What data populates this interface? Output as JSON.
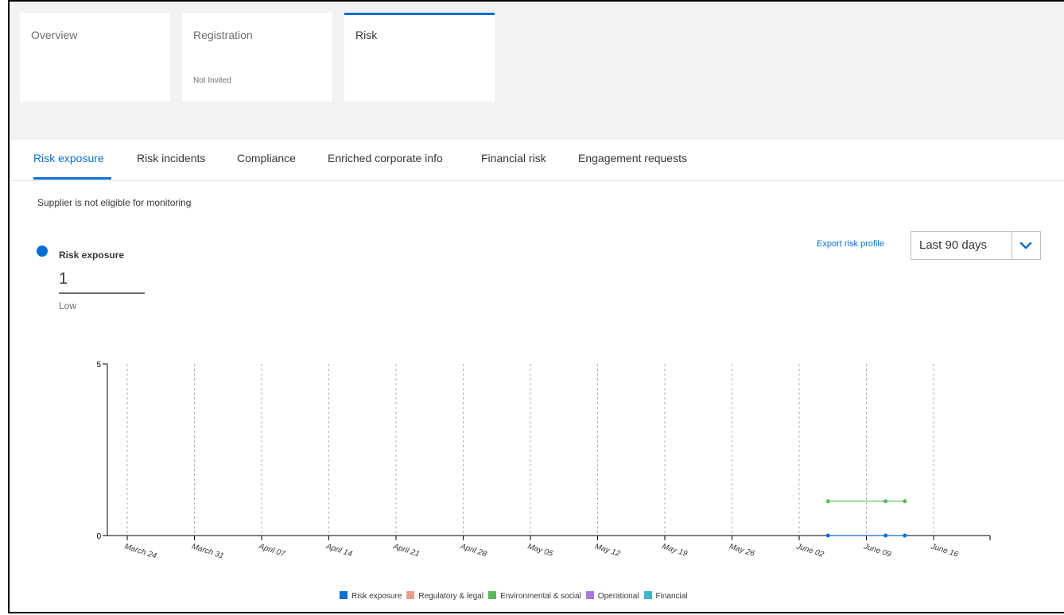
{
  "tiles": [
    {
      "title": "Overview",
      "subtitle": ""
    },
    {
      "title": "Registration",
      "subtitle": "Not Invited"
    },
    {
      "title": "Risk",
      "subtitle": ""
    }
  ],
  "tabs": [
    {
      "label": "Risk exposure",
      "active": true
    },
    {
      "label": "Risk incidents"
    },
    {
      "label": "Compliance"
    },
    {
      "label": "Enriched corporate info"
    },
    {
      "label": "Financial risk"
    },
    {
      "label": "Engagement requests"
    }
  ],
  "eligibility_message": "Supplier is not eligible for monitoring",
  "risk_summary": {
    "title": "Risk exposure",
    "value": "1",
    "level": "Low",
    "dot_color": "#0a6ed1"
  },
  "export_link": "Export risk profile",
  "range_select": {
    "value": "Last 90 days",
    "icon": "chevron-down-icon"
  },
  "colors": {
    "accent": "#0a6ed1"
  },
  "chart_data": {
    "type": "line",
    "x_categories": [
      "March 24",
      "March 31",
      "April 07",
      "April 14",
      "April 21",
      "April 28",
      "May 05",
      "May 12",
      "May 19",
      "May 26",
      "June 02",
      "June 09",
      "June 16"
    ],
    "ylim": [
      0,
      5
    ],
    "yticks": [
      0,
      5
    ],
    "grid": "vertical dashed",
    "legend_position": "bottom",
    "series": [
      {
        "name": "Risk exposure",
        "color": "#0a6ed1",
        "points": [
          [
            "June 05",
            0
          ],
          [
            "June 11",
            0
          ],
          [
            "June 13",
            0
          ]
        ]
      },
      {
        "name": "Regulatory & legal",
        "color": "#e8a28b",
        "points": []
      },
      {
        "name": "Environmental & social",
        "color": "#5cb85c",
        "points": [
          [
            "June 05",
            1
          ],
          [
            "June 11",
            1
          ],
          [
            "June 13",
            1
          ]
        ]
      },
      {
        "name": "Operational",
        "color": "#a77ad9",
        "points": []
      },
      {
        "name": "Financial",
        "color": "#3eb6c8",
        "points": []
      }
    ]
  }
}
